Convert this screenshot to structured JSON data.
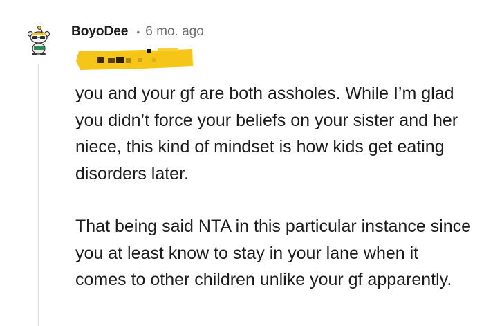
{
  "comment": {
    "username": "BoyoDee",
    "separator": "•",
    "timestamp": "6 mo. ago",
    "avatar_icon": "snoo-avatar-icon",
    "flair_icon": "redacted-flair-highlight",
    "flair_color": "#f5c518",
    "paragraphs": [
      "you and your gf are both assholes. While I’m glad you didn’t force your beliefs on your sister and her niece, this kind of mindset is how kids get eating disorders later.",
      "That being said NTA in this particular instance since you at least know to stay in your lane when it comes to other children unlike your gf apparently."
    ]
  }
}
